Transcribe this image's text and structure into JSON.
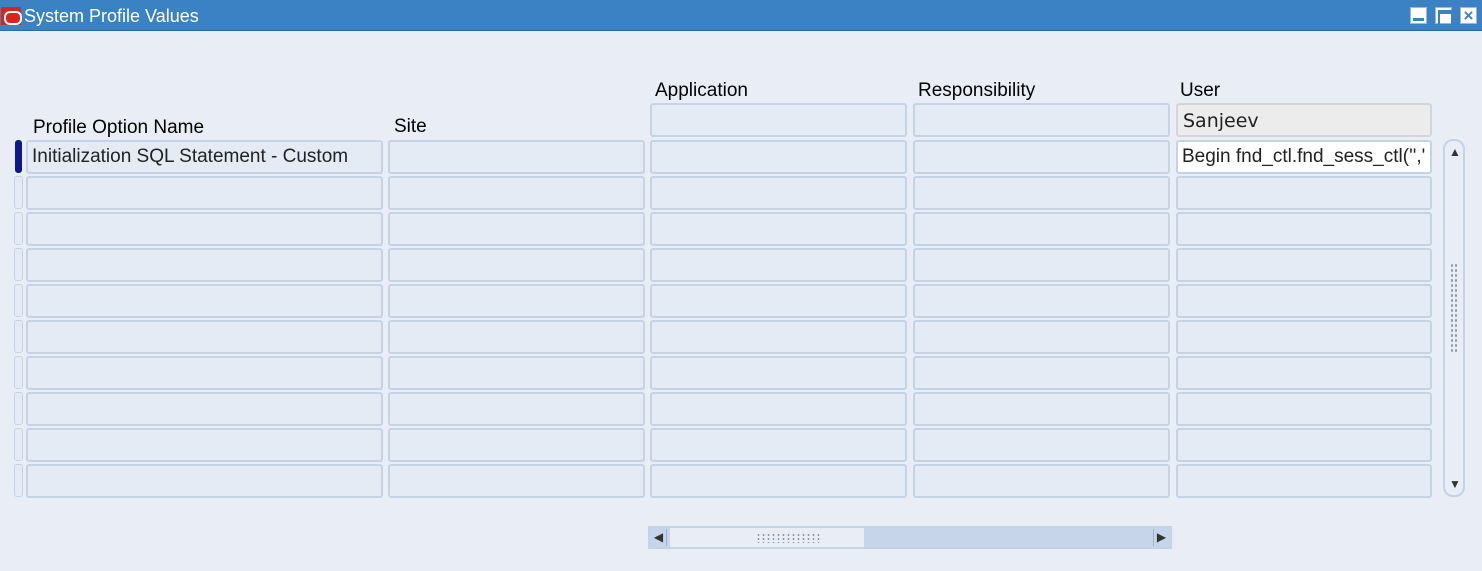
{
  "window": {
    "title": "System Profile Values"
  },
  "headers": {
    "profile_option_name": "Profile Option Name",
    "site": "Site",
    "application": "Application",
    "responsibility": "Responsibility",
    "user": "User"
  },
  "context": {
    "application": "",
    "responsibility": "",
    "user": "Sanjeev"
  },
  "rows": [
    {
      "name": "Initialization SQL Statement - Custom",
      "site": "",
      "application": "",
      "responsibility": "",
      "user": "Begin fnd_ctl.fnd_sess_ctl('','"
    },
    {
      "name": "",
      "site": "",
      "application": "",
      "responsibility": "",
      "user": ""
    },
    {
      "name": "",
      "site": "",
      "application": "",
      "responsibility": "",
      "user": ""
    },
    {
      "name": "",
      "site": "",
      "application": "",
      "responsibility": "",
      "user": ""
    },
    {
      "name": "",
      "site": "",
      "application": "",
      "responsibility": "",
      "user": ""
    },
    {
      "name": "",
      "site": "",
      "application": "",
      "responsibility": "",
      "user": ""
    },
    {
      "name": "",
      "site": "",
      "application": "",
      "responsibility": "",
      "user": ""
    },
    {
      "name": "",
      "site": "",
      "application": "",
      "responsibility": "",
      "user": ""
    },
    {
      "name": "",
      "site": "",
      "application": "",
      "responsibility": "",
      "user": ""
    },
    {
      "name": "",
      "site": "",
      "application": "",
      "responsibility": "",
      "user": ""
    }
  ],
  "colors": {
    "titlebar": "#3b82c4",
    "current_row_indicator": "#0a1a8a"
  },
  "icons": {
    "app": "oracle-logo-icon",
    "minimize": "minimize-icon",
    "maximize": "maximize-icon",
    "close": "close-icon"
  }
}
